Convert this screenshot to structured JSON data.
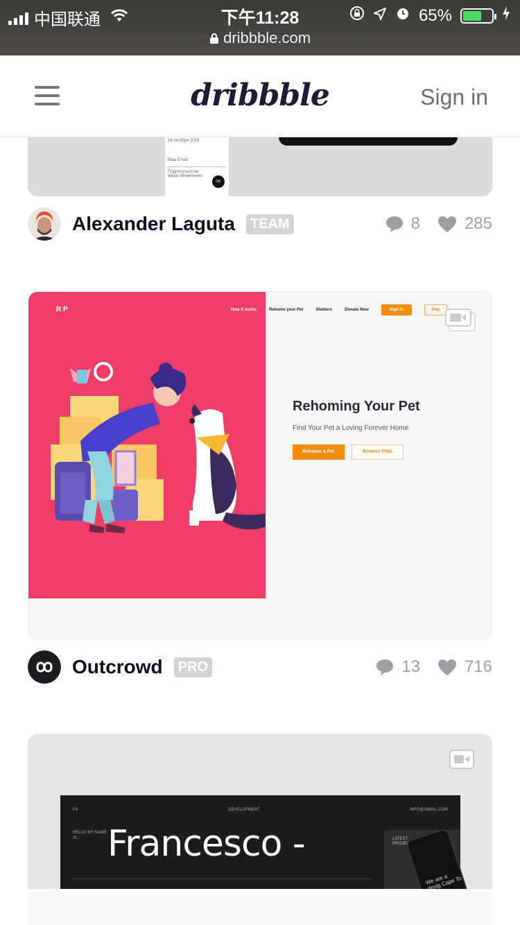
{
  "status_bar": {
    "carrier": "中国联通",
    "time": "下午11:28",
    "url": "dribbble.com",
    "battery_percent": "65%",
    "battery_level": 0.65,
    "battery_color": "#4cd964"
  },
  "navbar": {
    "logo": "dribbble",
    "sign_in": "Sign in"
  },
  "shots": [
    {
      "author": "Alexander Laguta",
      "badge": "TEAM",
      "comments": "8",
      "likes": "285",
      "preview": {
        "subtitle": "18 октября 2019",
        "field_label": "Ваш Email",
        "note": "Подписаться на наши обновления",
        "ok": "OK"
      }
    },
    {
      "author": "Outcrowd",
      "badge": "PRO",
      "comments": "13",
      "likes": "716",
      "preview": {
        "logo": "R P",
        "nav": [
          "How it works",
          "Rehome your Pet",
          "Shelters",
          "Donate Now"
        ],
        "sign_in": "Sign In",
        "register": "Reg",
        "title": "Rehoming Your Pet",
        "subtitle": "Find Your Pet a Loving Forever Home",
        "primary_button": "Rehome a Pet",
        "secondary_button": "Browse Pets",
        "accent": "#ee3d66",
        "button_color": "#f58b0a"
      }
    },
    {
      "preview": {
        "left": "FA",
        "center": "DEVELOPMENT",
        "right": "INFO@GMAIL.COM",
        "hello": "HELLO MY NAME IS...",
        "name": "Francesco -",
        "panel_label": "LATEST PROJECT",
        "phone_text": "We are a desig Cape To"
      }
    }
  ]
}
